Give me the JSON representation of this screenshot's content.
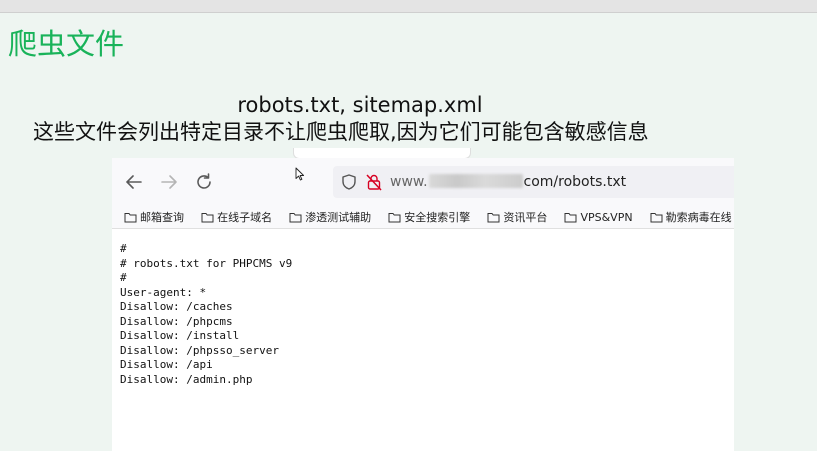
{
  "slide": {
    "title": "爬虫文件",
    "line1": "robots.txt, sitemap.xml",
    "line2": "这些文件会列出特定目录不让爬虫爬取,因为它们可能包含敏感信息"
  },
  "browser": {
    "url_prefix": "www.",
    "url_suffix": "com/robots.txt",
    "bookmarks": [
      "邮箱查询",
      "在线子域名",
      "渗透测试辅助",
      "安全搜索引擎",
      "资讯平台",
      "VPS&VPN",
      "勒索病毒在线"
    ],
    "robots_lines": [
      "#",
      "# robots.txt for PHPCMS v9",
      "#",
      "User-agent: *",
      "Disallow: /caches",
      "Disallow: /phpcms",
      "Disallow: /install",
      "Disallow: /phpsso_server",
      "Disallow: /api",
      "Disallow: /admin.php"
    ]
  },
  "colors": {
    "title": "#19b35a",
    "background": "#eef5f1",
    "insecure": "#d70022"
  },
  "icons": [
    "back-arrow-icon",
    "forward-arrow-icon",
    "reload-icon",
    "shield-icon",
    "insecure-lock-icon",
    "folder-icon",
    "mouse-cursor-icon"
  ]
}
